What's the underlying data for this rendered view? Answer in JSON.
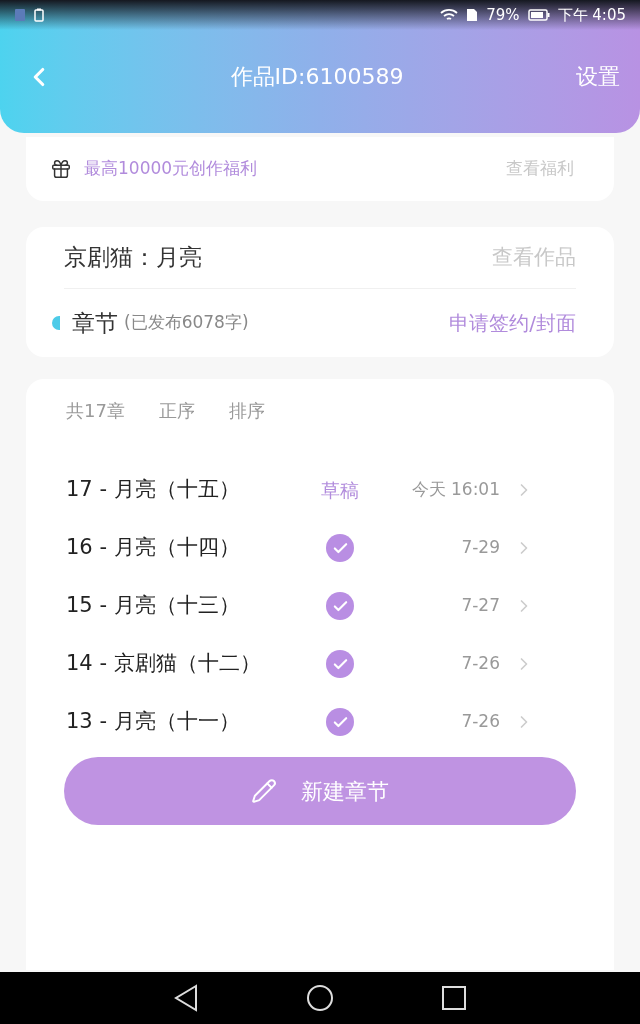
{
  "status_bar": {
    "battery": "79%",
    "time": "下午 4:05"
  },
  "header": {
    "title": "作品ID:6100589",
    "action": "设置"
  },
  "promo": {
    "text": "最高10000元创作福利",
    "link": "查看福利"
  },
  "work": {
    "title": "京剧猫：月亮",
    "view_link": "查看作品",
    "section_label": "章节",
    "published_note": "(已发布6078字)",
    "apply_link": "申请签约/封面"
  },
  "chapter_list": {
    "count": "共17章",
    "sort_options": [
      {
        "label": "正序"
      },
      {
        "label": "排序"
      }
    ],
    "chapters": [
      {
        "title": "17 - 月亮（十五）",
        "kind": "draft",
        "status_label": "草稿",
        "date": "今天 16:01"
      },
      {
        "title": "16 - 月亮（十四）",
        "kind": "published",
        "date": "7-29"
      },
      {
        "title": "15 - 月亮（十三）",
        "kind": "published",
        "date": "7-27"
      },
      {
        "title": "14 - 京剧猫（十二）",
        "kind": "published",
        "date": "7-26"
      },
      {
        "title": "13 - 月亮（十一）",
        "kind": "published",
        "date": "7-26"
      }
    ]
  },
  "new_chapter_button": "新建章节"
}
